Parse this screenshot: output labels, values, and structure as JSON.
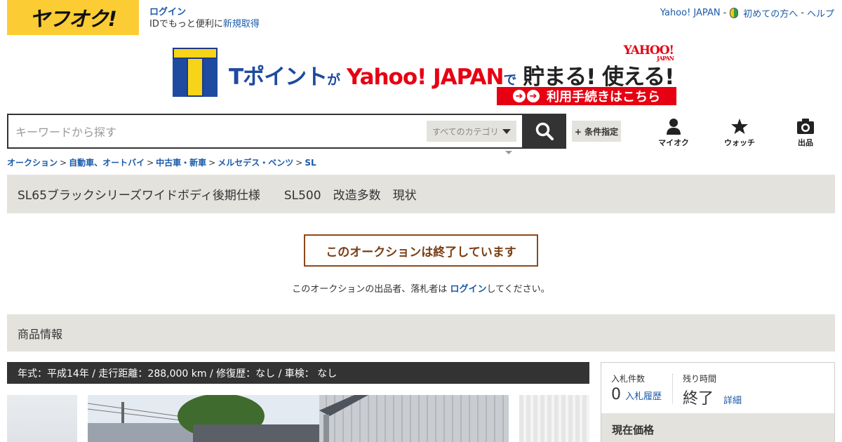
{
  "header": {
    "logo": "ヤフオク!",
    "login_label": "ログイン",
    "id_prefix": "IDでもっと便利に",
    "register_label": "新規取得",
    "yahoo_japan": "Yahoo! JAPAN",
    "sep": "-",
    "first_time": "初めての方へ",
    "help": "ヘルプ"
  },
  "banner": {
    "t_point": "Tポイント",
    "ga": "が",
    "yahoo_japan": "Yahoo! JAPAN",
    "de": "で",
    "tamaru": "貯まる! 使える!",
    "logo_text": "YAHOO!",
    "logo_sub": "JAPAN",
    "cta": "利用手続きはこちら"
  },
  "search": {
    "placeholder": "キーワードから探す",
    "category": "すべてのカテゴリ",
    "conditions": "+ 条件指定"
  },
  "nav": {
    "myauction": "マイオク",
    "watch": "ウォッチ",
    "sell": "出品"
  },
  "breadcrumb": [
    "オークション",
    "自動車、オートバイ",
    "中古車・新車",
    "メルセデス・ベンツ",
    "SL"
  ],
  "breadcrumb_sep": ">",
  "title": "SL65ブラックシリーズワイドボディ後期仕様　　SL500　改造多数　現状",
  "ended": {
    "message": "このオークションは終了しています",
    "note_prefix": "このオークションの出品者、落札者は ",
    "note_link": "ログイン",
    "note_suffix": "してください。"
  },
  "product": {
    "section_title": "商品情報",
    "spec": "年式：平成14年 / 走行距離：288,000 km / 修復歴：なし / 車検： なし"
  },
  "bid_panel": {
    "bids_label": "入札件数",
    "bids_value": "0",
    "bid_history": "入札履歴",
    "remain_label": "残り時間",
    "remain_value": "終了",
    "detail": "詳細",
    "price_label": "現在価格"
  },
  "colors": {
    "yellow": "#fccc34",
    "link": "#1a5aa8",
    "ended_border": "#8b4a1c",
    "gray_bar": "#e3e2dd"
  }
}
